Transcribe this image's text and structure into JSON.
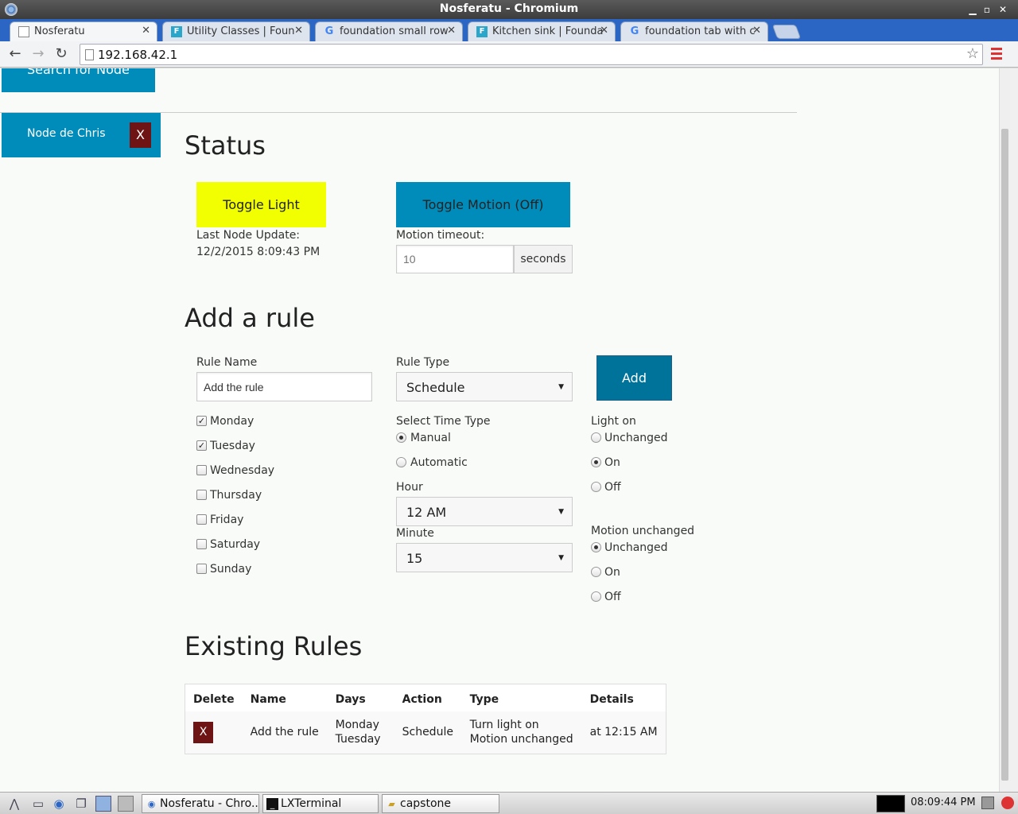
{
  "window": {
    "title": "Nosferatu - Chromium",
    "minimize": "▁",
    "maximize": "▫",
    "close": "✕"
  },
  "tabs": [
    {
      "label": "Nosferatu",
      "favicon": "doc-icon",
      "close": "✕"
    },
    {
      "label": "Utility Classes | Foun",
      "favicon": "F",
      "close": "✕"
    },
    {
      "label": "foundation small row",
      "favicon": "G",
      "close": "✕"
    },
    {
      "label": "Kitchen sink | Founda",
      "favicon": "F",
      "close": "✕"
    },
    {
      "label": "foundation tab with c",
      "favicon": "G",
      "close": "✕"
    }
  ],
  "toolbar": {
    "back": "←",
    "forward": "→",
    "reload": "↻",
    "url": "192.168.42.1",
    "star": "☆"
  },
  "sidebar": {
    "search_node": "Search for Node",
    "node_name": "Node de Chris",
    "node_remove": "X"
  },
  "status": {
    "heading": "Status",
    "toggle_light": "Toggle Light",
    "toggle_motion": "Toggle Motion (Off)",
    "last_update_label": "Last Node Update:",
    "last_update_value": "12/2/2015 8:09:43 PM",
    "motion_timeout_label": "Motion timeout:",
    "motion_timeout_placeholder": "10",
    "motion_timeout_unit": "seconds"
  },
  "add_rule": {
    "heading": "Add a rule",
    "rule_name_label": "Rule Name",
    "rule_name_value": "Add the rule",
    "rule_type_label": "Rule Type",
    "rule_type_value": "Schedule",
    "add_button": "Add",
    "days": [
      {
        "label": "Monday",
        "checked": true
      },
      {
        "label": "Tuesday",
        "checked": true
      },
      {
        "label": "Wednesday",
        "checked": false
      },
      {
        "label": "Thursday",
        "checked": false
      },
      {
        "label": "Friday",
        "checked": false
      },
      {
        "label": "Saturday",
        "checked": false
      },
      {
        "label": "Sunday",
        "checked": false
      }
    ],
    "time_type_label": "Select Time Type",
    "time_types": [
      {
        "label": "Manual",
        "selected": true
      },
      {
        "label": "Automatic",
        "selected": false
      }
    ],
    "hour_label": "Hour",
    "hour_value": "12 AM",
    "minute_label": "Minute",
    "minute_value": "15",
    "light_label": "Light on",
    "light_options": [
      {
        "label": "Unchanged",
        "selected": false
      },
      {
        "label": "On",
        "selected": true
      },
      {
        "label": "Off",
        "selected": false
      }
    ],
    "motion_label": "Motion unchanged",
    "motion_options": [
      {
        "label": "Unchanged",
        "selected": true
      },
      {
        "label": "On",
        "selected": false
      },
      {
        "label": "Off",
        "selected": false
      }
    ]
  },
  "existing_rules": {
    "heading": "Existing Rules",
    "columns": [
      "Delete",
      "Name",
      "Days",
      "Action",
      "Type",
      "Details"
    ],
    "rows": [
      {
        "delete": "X",
        "name": "Add the rule",
        "days_1": "Monday",
        "days_2": "Tuesday",
        "action": "Schedule",
        "type_1": "Turn light on",
        "type_2": "Motion unchanged",
        "details": "at 12:15 AM"
      }
    ]
  },
  "taskbar": {
    "tasks": [
      {
        "label": "Nosferatu - Chro...",
        "icon": "chromium-icon"
      },
      {
        "label": "LXTerminal",
        "icon": "terminal-icon"
      },
      {
        "label": "capstone",
        "icon": "folder-icon"
      }
    ],
    "clock": "08:09:44 PM"
  },
  "colors": {
    "primary_button": "#008cba",
    "toggle_light_button": "#f2ff00",
    "add_button": "#00739a",
    "delete_button": "#6e1414",
    "tabstrip": "#2b66c4"
  }
}
